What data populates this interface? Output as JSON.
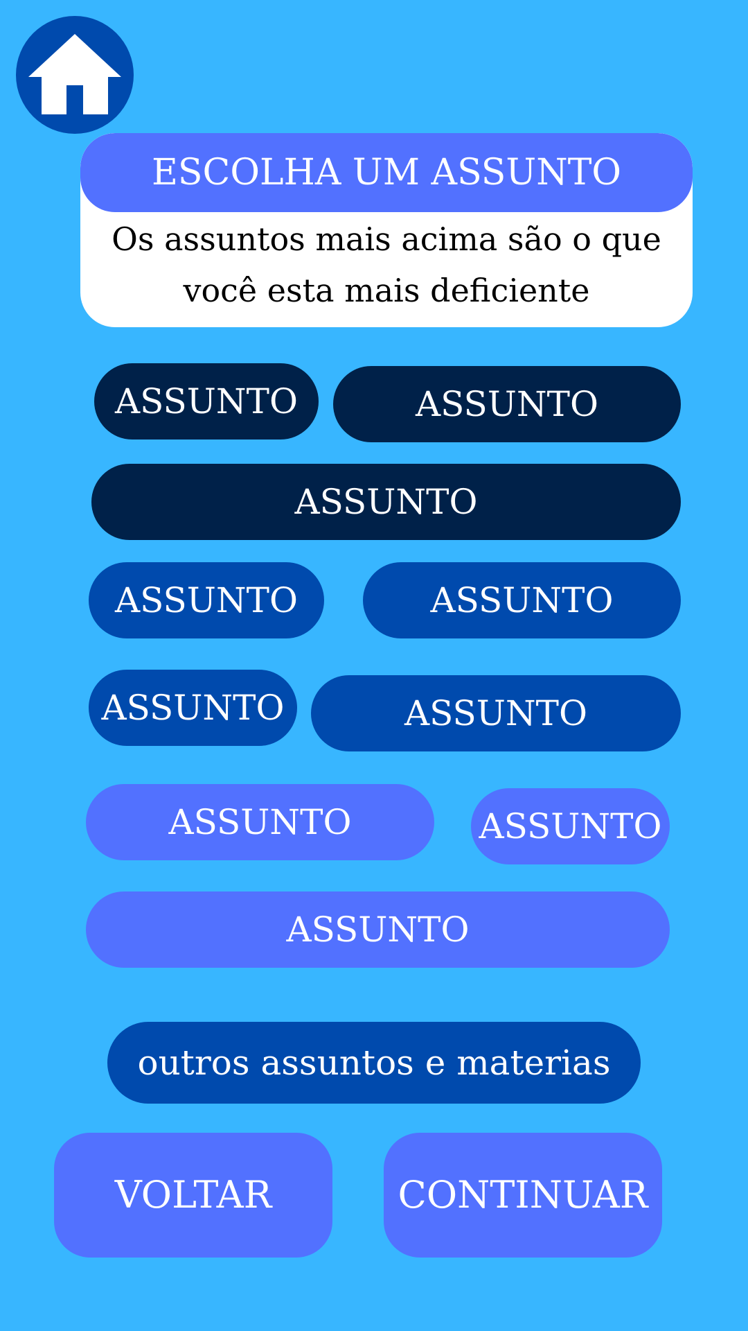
{
  "header": {
    "title": "ESCOLHA UM ASSUNTO",
    "subtitle": "Os assuntos mais acima são o que você esta mais deficiente"
  },
  "home": {
    "icon": "home-icon"
  },
  "subjects": [
    {
      "label": "ASSUNTO"
    },
    {
      "label": "ASSUNTO"
    },
    {
      "label": "ASSUNTO"
    },
    {
      "label": "ASSUNTO"
    },
    {
      "label": "ASSUNTO"
    },
    {
      "label": "ASSUNTO"
    },
    {
      "label": "ASSUNTO"
    },
    {
      "label": "ASSUNTO"
    },
    {
      "label": "ASSUNTO"
    },
    {
      "label": "ASSUNTO"
    }
  ],
  "more_button": {
    "label": "outros assuntos e materias"
  },
  "actions": {
    "back_label": "VOLTAR",
    "continue_label": "CONTINUAR"
  },
  "colors": {
    "background": "#38b6ff",
    "navy": "#002149",
    "blue": "#004aad",
    "light_blue": "#5271ff",
    "white": "#ffffff"
  }
}
